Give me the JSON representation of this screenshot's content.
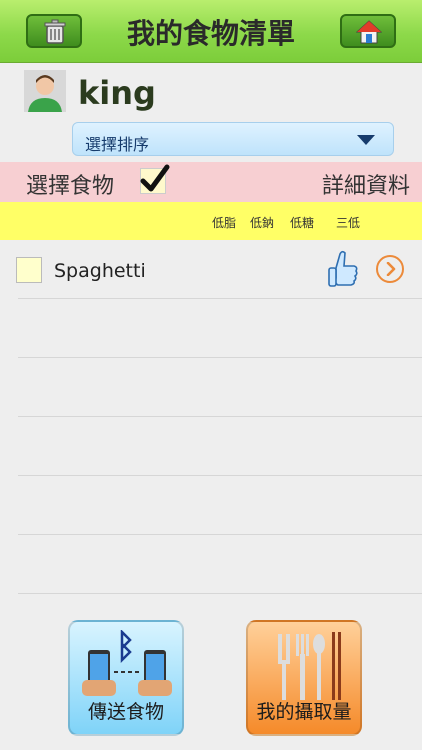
{
  "header": {
    "title": "我的食物清單",
    "left_icon": "trash-icon",
    "right_icon": "home-icon"
  },
  "user": {
    "name": "king"
  },
  "sort": {
    "label": "選擇排序"
  },
  "selection_bar": {
    "left_label": "選擇食物",
    "right_label": "詳細資料",
    "checked": true
  },
  "filters": [
    "低脂",
    "低鈉",
    "低糖",
    "三低"
  ],
  "items": [
    {
      "name": "Spaghetti",
      "checked": false,
      "thumb_icon": "thumbs-up-icon",
      "detail_icon": "chevron-right-icon"
    }
  ],
  "bottom_buttons": {
    "send": "傳送食物",
    "intake": "我的攝取量"
  },
  "colors": {
    "header": "#8dd94a",
    "pink": "#f7cfd2",
    "yellow": "#ffff66",
    "accent": "#ec8a3a"
  }
}
